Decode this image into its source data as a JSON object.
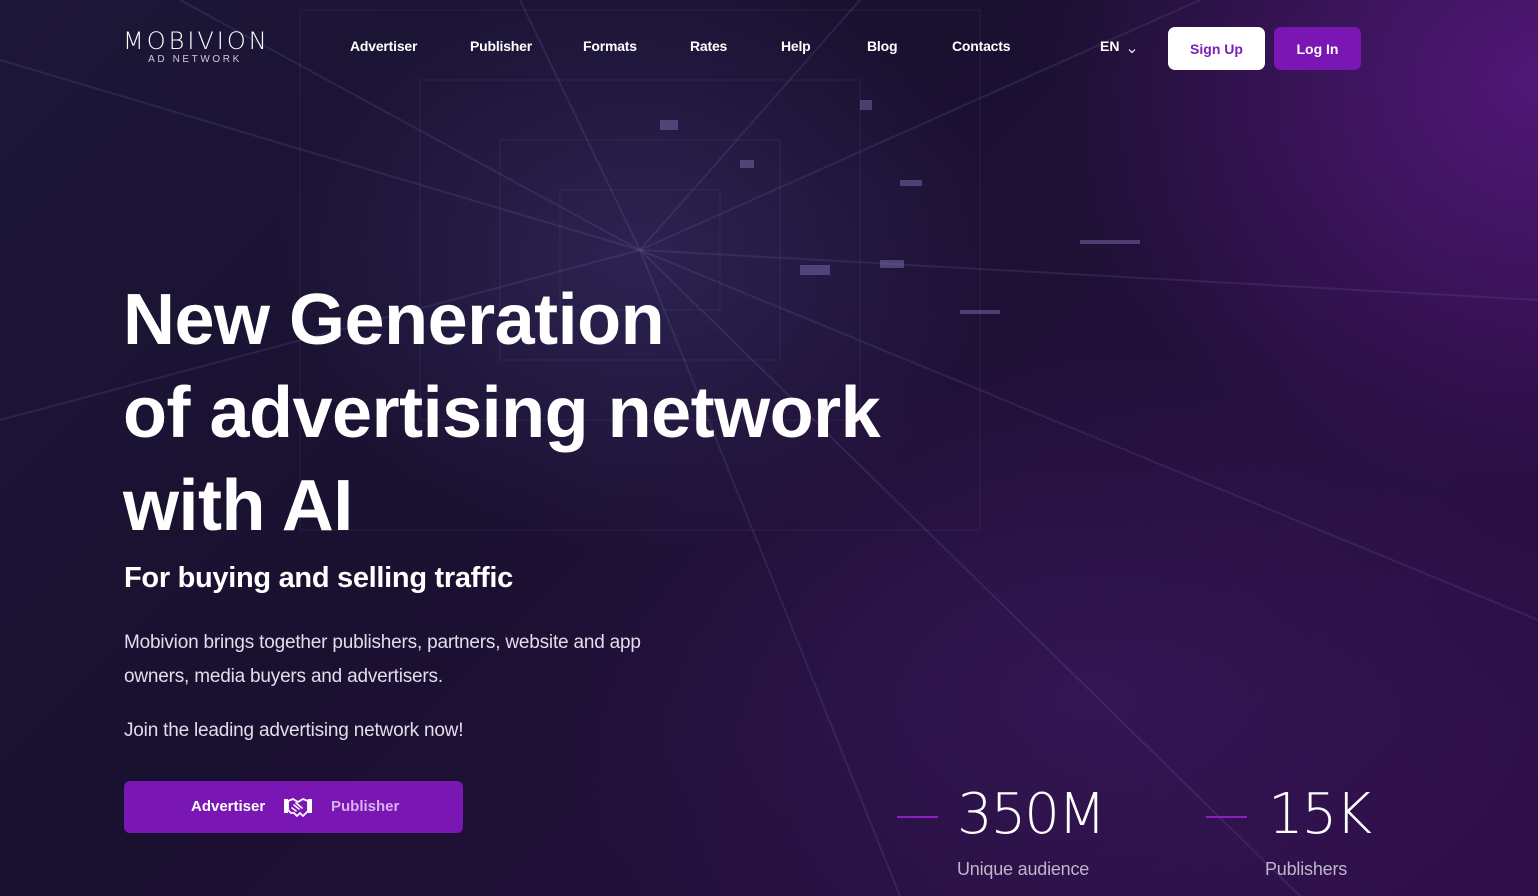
{
  "brand": {
    "name": "MOBIVION",
    "tagline": "AD NETWORK"
  },
  "nav": {
    "items": [
      {
        "label": "Advertiser"
      },
      {
        "label": "Publisher"
      },
      {
        "label": "Formats"
      },
      {
        "label": "Rates"
      },
      {
        "label": "Help"
      },
      {
        "label": "Blog"
      },
      {
        "label": "Contacts"
      }
    ],
    "language": "EN",
    "signup_label": "Sign Up",
    "login_label": "Log In"
  },
  "hero": {
    "title_lines": [
      "New Generation",
      "of advertising network",
      "with AI"
    ],
    "subtitle": "For buying and selling traffic",
    "description": "Mobivion brings together publishers, partners, website and app owners, media buyers and advertisers.",
    "join_text": "Join the leading advertising network now!",
    "cta": {
      "advertiser_label": "Advertiser",
      "publisher_label": "Publisher",
      "icon": "handshake-icon"
    }
  },
  "stats": [
    {
      "value": "350M",
      "label": "Unique audience"
    },
    {
      "value": "15K",
      "label": "Publishers"
    }
  ],
  "colors": {
    "accent": "#7a16b4",
    "background": "#1a0d2c",
    "text": "#ffffff"
  }
}
